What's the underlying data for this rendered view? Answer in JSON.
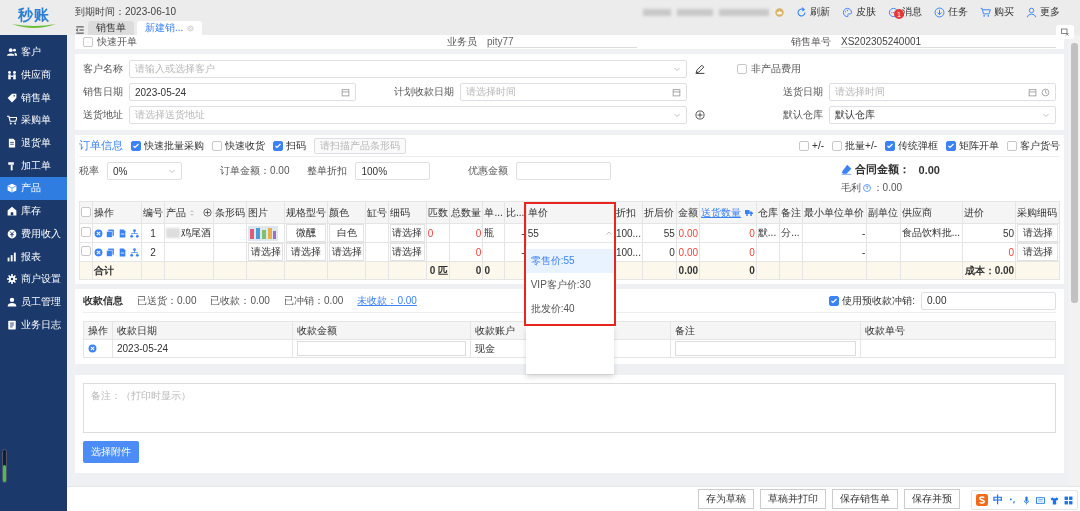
{
  "app": {
    "logo": "秒账",
    "expiry": "到期时间：2023-06-10"
  },
  "tabs": [
    {
      "label": "销售单",
      "selected": false
    },
    {
      "label": "新建销...",
      "selected": true
    }
  ],
  "toolbar": [
    {
      "label": "刷新"
    },
    {
      "label": "皮肤"
    },
    {
      "label": "消息",
      "badge": "1"
    },
    {
      "label": "任务"
    },
    {
      "label": "购买"
    },
    {
      "label": "更多"
    }
  ],
  "sidebar": {
    "items": [
      {
        "label": "客户",
        "selected": false
      },
      {
        "label": "供应商",
        "selected": false
      },
      {
        "label": "销售单",
        "selected": false
      },
      {
        "label": "采购单",
        "selected": false
      },
      {
        "label": "退货单",
        "selected": false
      },
      {
        "label": "加工单",
        "selected": false
      },
      {
        "label": "产品",
        "selected": true
      },
      {
        "label": "库存",
        "selected": false
      },
      {
        "label": "费用收入",
        "selected": false
      },
      {
        "label": "报表",
        "selected": false
      },
      {
        "label": "商户设置",
        "selected": false
      },
      {
        "label": "员工管理",
        "selected": false
      },
      {
        "label": "业务日志",
        "selected": false
      }
    ]
  },
  "top_row": {
    "quick_order": {
      "label": "快速开单",
      "checked": false
    },
    "salesperson": {
      "label": "业务员",
      "value": "pity77"
    },
    "order_no": {
      "label": "销售单号",
      "value": "XS202305240001"
    }
  },
  "form": {
    "rows": [
      [
        {
          "kind": "select",
          "label": "客户名称",
          "placeholder": "请输入或选择客户",
          "edit_button": true
        },
        {
          "kind": "checkbox",
          "label": "非产品费用",
          "checked": false
        }
      ],
      [
        {
          "kind": "date",
          "label": "销售日期",
          "value": "2023-05-24"
        },
        {
          "kind": "date",
          "label": "计划收款日期",
          "placeholder": "请选择时间"
        },
        {
          "kind": "datetime",
          "label": "送货日期",
          "placeholder": "请选择时间"
        }
      ],
      [
        {
          "kind": "select",
          "label": "送货地址",
          "placeholder": "请选择送货地址",
          "add_button": true
        },
        {
          "kind": "select",
          "label": "默认仓库",
          "value": "默认仓库"
        }
      ]
    ]
  },
  "order": {
    "title": "订单信息",
    "options": [
      {
        "label": "快速批量采购",
        "checked": true
      },
      {
        "label": "快速收货",
        "checked": false
      },
      {
        "label": "扫码",
        "checked": true
      }
    ],
    "scan_placeholder": "请扫描产品条形码",
    "toggles": [
      {
        "label": "+/-",
        "checked": false
      },
      {
        "label": "批量+/-",
        "checked": false
      },
      {
        "label": "传统弹框",
        "checked": true
      },
      {
        "label": "矩阵开单",
        "checked": true
      },
      {
        "label": "客户货号",
        "checked": false
      }
    ],
    "tax": {
      "label": "税率",
      "value": "0%"
    },
    "order_amount": "订单金额：0.00",
    "discount": {
      "label": "整单折扣",
      "value": "100%"
    },
    "coupon": {
      "label": "优惠金额"
    },
    "contract": {
      "label": "合同金额：",
      "value": "0.00"
    },
    "profit": {
      "label": "毛利",
      "value": "：0.00"
    },
    "table": {
      "select_all": {
        "checked": false
      },
      "columns": [
        {
          "label": "操作",
          "kind": "plain"
        },
        {
          "label": "编号",
          "kind": "plain"
        },
        {
          "label": "产品",
          "kind": "sortable"
        },
        {
          "label": "条形码",
          "kind": "plain"
        },
        {
          "label": "图片",
          "kind": "plain"
        },
        {
          "label": "规格型号",
          "kind": "plain"
        },
        {
          "label": "颜色",
          "kind": "plain"
        },
        {
          "label": "缸号",
          "kind": "plain"
        },
        {
          "label": "细码",
          "kind": "plain"
        },
        {
          "label": "匹数",
          "kind": "plain"
        },
        {
          "label": "总数量",
          "kind": "plain"
        },
        {
          "label": "单...",
          "kind": "plain"
        },
        {
          "label": "比...",
          "kind": "plain"
        },
        {
          "label": "单价",
          "kind": "menu"
        },
        {
          "label": "折扣",
          "kind": "plain"
        },
        {
          "label": "折后价",
          "kind": "plain"
        },
        {
          "label": "金额",
          "kind": "plain"
        },
        {
          "label": "送货数量",
          "kind": "link"
        },
        {
          "label": "仓库",
          "kind": "plain"
        },
        {
          "label": "备注",
          "kind": "plain"
        },
        {
          "label": "最小单位单价",
          "kind": "plain"
        },
        {
          "label": "副单位",
          "kind": "plain"
        },
        {
          "label": "供应商",
          "kind": "plain"
        },
        {
          "label": "进价",
          "kind": "plain"
        },
        {
          "label": "采购细码",
          "kind": "plain"
        }
      ],
      "rows": [
        {
          "checked": false,
          "cells": [
            {
              "kind": "actions"
            },
            {
              "kind": "index",
              "text": "1"
            },
            {
              "kind": "product",
              "text": "鸡尾酒"
            },
            {
              "kind": "blank"
            },
            {
              "kind": "image"
            },
            {
              "kind": "pick",
              "text": "微醺"
            },
            {
              "kind": "pick",
              "text": "白色"
            },
            {
              "kind": "blank"
            },
            {
              "kind": "pick",
              "text": "请选择"
            },
            {
              "kind": "text",
              "text": "0",
              "alert": true
            },
            {
              "kind": "num",
              "text": "0",
              "alert": true
            },
            {
              "kind": "text",
              "text": "瓶"
            },
            {
              "kind": "num",
              "text": "-"
            },
            {
              "kind": "price",
              "text": "55"
            },
            {
              "kind": "text",
              "text": "100..."
            },
            {
              "kind": "num",
              "text": "55"
            },
            {
              "kind": "num",
              "text": "0.00",
              "alert": true
            },
            {
              "kind": "num",
              "text": "0",
              "alert": true
            },
            {
              "kind": "text",
              "text": "默..."
            },
            {
              "kind": "text",
              "text": "分..."
            },
            {
              "kind": "num",
              "text": "-"
            },
            {
              "kind": "blank"
            },
            {
              "kind": "text",
              "text": "食品饮料批..."
            },
            {
              "kind": "num",
              "text": "50"
            },
            {
              "kind": "pick",
              "text": "请选择"
            }
          ]
        },
        {
          "checked": false,
          "cells": [
            {
              "kind": "actions"
            },
            {
              "kind": "index",
              "text": "2"
            },
            {
              "kind": "blank"
            },
            {
              "kind": "blank"
            },
            {
              "kind": "pick",
              "text": "请选择"
            },
            {
              "kind": "pick",
              "text": "请选择"
            },
            {
              "kind": "pick",
              "text": "请选择"
            },
            {
              "kind": "blank"
            },
            {
              "kind": "pick",
              "text": "请选择"
            },
            {
              "kind": "blank"
            },
            {
              "kind": "num",
              "text": "0",
              "alert": true
            },
            {
              "kind": "blank"
            },
            {
              "kind": "num",
              "text": "-"
            },
            {
              "kind": "blank"
            },
            {
              "kind": "text",
              "text": "100..."
            },
            {
              "kind": "num",
              "text": "0"
            },
            {
              "kind": "num",
              "text": "0.00",
              "alert": true
            },
            {
              "kind": "num",
              "text": "0",
              "alert": true
            },
            {
              "kind": "blank"
            },
            {
              "kind": "blank"
            },
            {
              "kind": "num",
              "text": "-"
            },
            {
              "kind": "blank"
            },
            {
              "kind": "blank"
            },
            {
              "kind": "num",
              "text": "0",
              "alert": true
            },
            {
              "kind": "pick",
              "text": "请选择"
            }
          ]
        }
      ],
      "totals": [
        {
          "kind": "text",
          "text": "合计"
        },
        {
          "kind": "blank"
        },
        {
          "kind": "blank"
        },
        {
          "kind": "blank"
        },
        {
          "kind": "blank"
        },
        {
          "kind": "blank"
        },
        {
          "kind": "blank"
        },
        {
          "kind": "blank"
        },
        {
          "kind": "blank"
        },
        {
          "kind": "num",
          "text": "0 匹"
        },
        {
          "kind": "num",
          "text": "0"
        },
        {
          "kind": "text",
          "text": "0"
        },
        {
          "kind": "blank"
        },
        {
          "kind": "blank"
        },
        {
          "kind": "blank"
        },
        {
          "kind": "blank"
        },
        {
          "kind": "num",
          "text": "0.00"
        },
        {
          "kind": "num",
          "text": "0"
        },
        {
          "kind": "blank"
        },
        {
          "kind": "blank"
        },
        {
          "kind": "blank"
        },
        {
          "kind": "blank"
        },
        {
          "kind": "blank"
        },
        {
          "kind": "num",
          "text": "成本：0.00"
        },
        {
          "kind": "blank"
        }
      ],
      "price_menu": {
        "annotated": true,
        "options": [
          {
            "label": "零售价:55",
            "selected": true
          },
          {
            "label": "VIP客户价:30",
            "selected": false
          },
          {
            "label": "批发价:40",
            "selected": false
          }
        ]
      }
    }
  },
  "payment": {
    "title": "收款信息",
    "summary": [
      {
        "text": "已送货：0.00",
        "kind": "text"
      },
      {
        "text": "已收款：0.00",
        "kind": "text"
      },
      {
        "text": "已冲销：0.00",
        "kind": "text"
      },
      {
        "text": "未收款：0.00",
        "kind": "link"
      }
    ],
    "prepaid": {
      "label": "使用预收款冲销:",
      "checked": true,
      "value": "0.00"
    },
    "columns": [
      "操作",
      "收款日期",
      "收款金额",
      "收款账户",
      "备注",
      "收款单号"
    ],
    "rows": [
      {
        "date": "2023-05-24",
        "account": "现金"
      }
    ]
  },
  "notes": {
    "placeholder": "备注：（打印时显示）",
    "attach": "选择附件"
  },
  "footer": {
    "buttons": [
      "存为草稿",
      "草稿并打印",
      "保存销售单",
      "保存并预"
    ]
  },
  "ime": {
    "label": "中"
  }
}
